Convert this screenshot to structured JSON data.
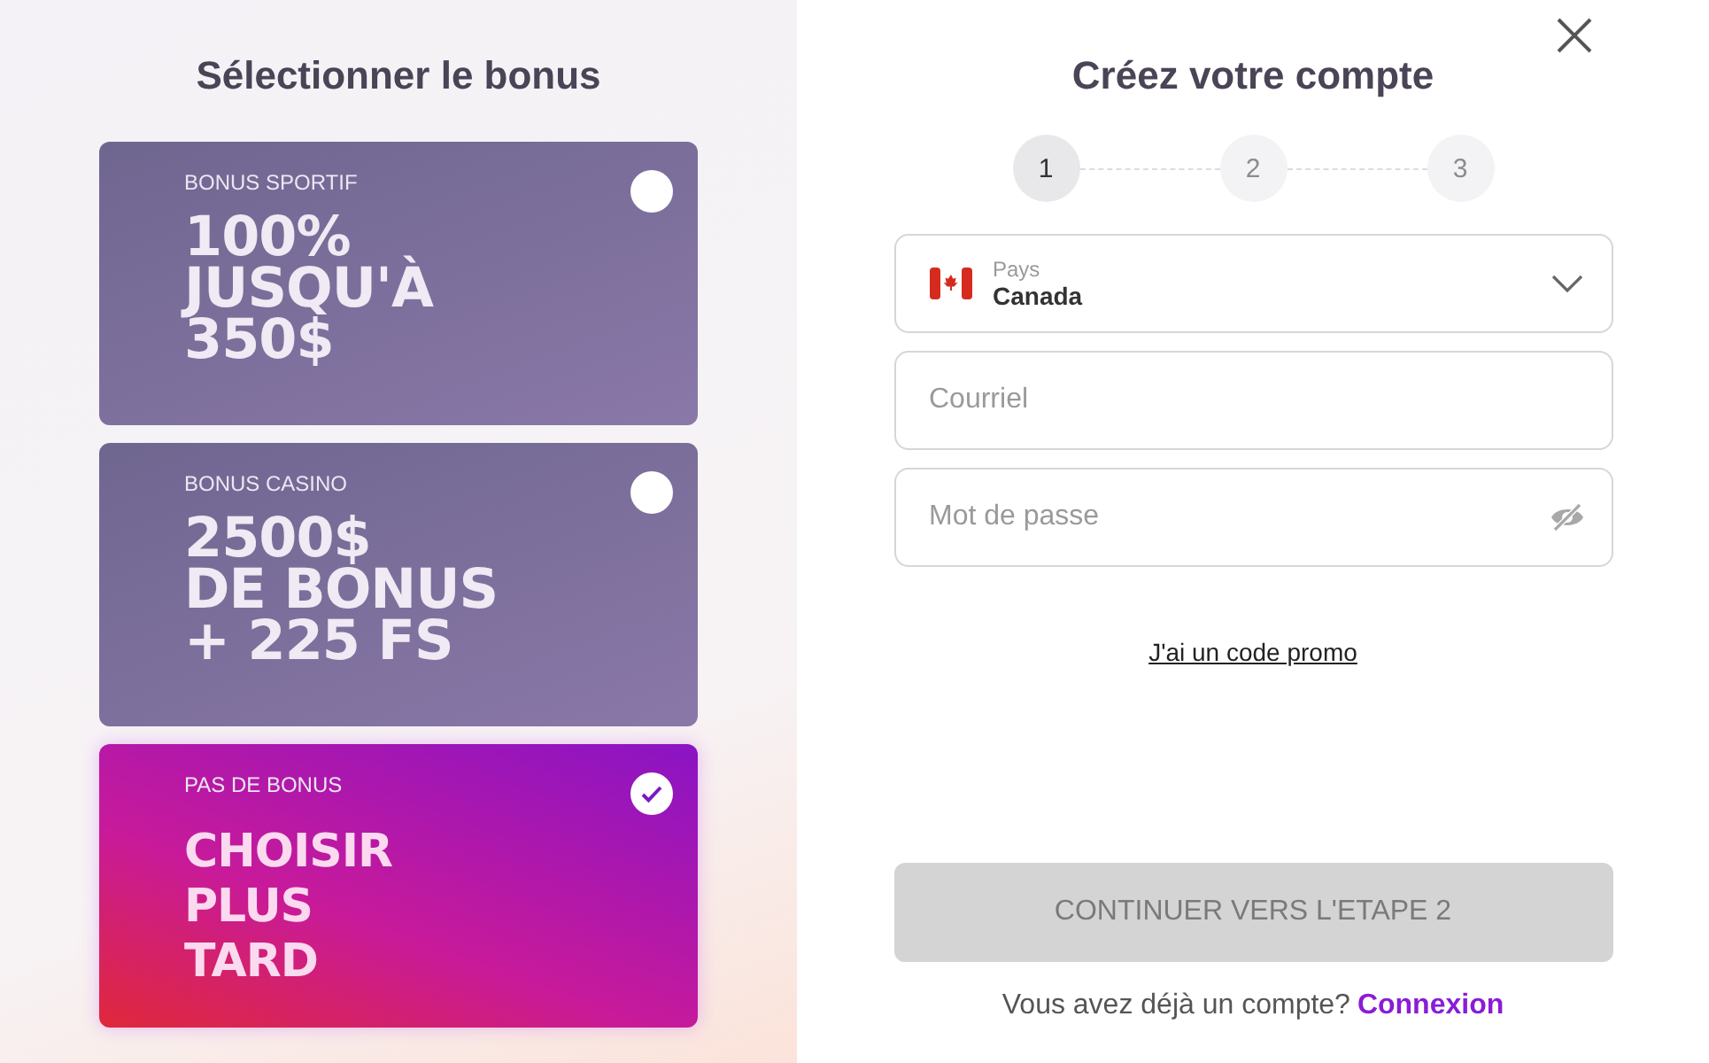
{
  "bonus_panel": {
    "title": "Sélectionner le bonus",
    "cards": [
      {
        "label": "BONUS SPORTIF",
        "offer": "100%\nJUSQU'À\n350$",
        "selected": false
      },
      {
        "label": "BONUS CASINO",
        "offer": "2500$\nDE BONUS\n+ 225 FS",
        "selected": false
      },
      {
        "label": "PAS DE BONUS",
        "offer": "CHOISIR\nPLUS\nTARD",
        "selected": true
      }
    ]
  },
  "signup": {
    "title": "Créez votre compte",
    "steps": [
      {
        "label": "1",
        "selected": true
      },
      {
        "label": "2",
        "selected": false
      },
      {
        "label": "3",
        "selected": false
      }
    ],
    "country": {
      "label": "Pays",
      "value": "Canada"
    },
    "email": {
      "placeholder": "Courriel"
    },
    "password": {
      "placeholder": "Mot de passe"
    },
    "promo_link": "J'ai un code promo",
    "continue_button": {
      "label": "CONTINUER VERS L'ETAPE 2",
      "disabled": true
    },
    "login_prompt": "Vous avez déjà un compte?",
    "login_link": "Connexion"
  }
}
